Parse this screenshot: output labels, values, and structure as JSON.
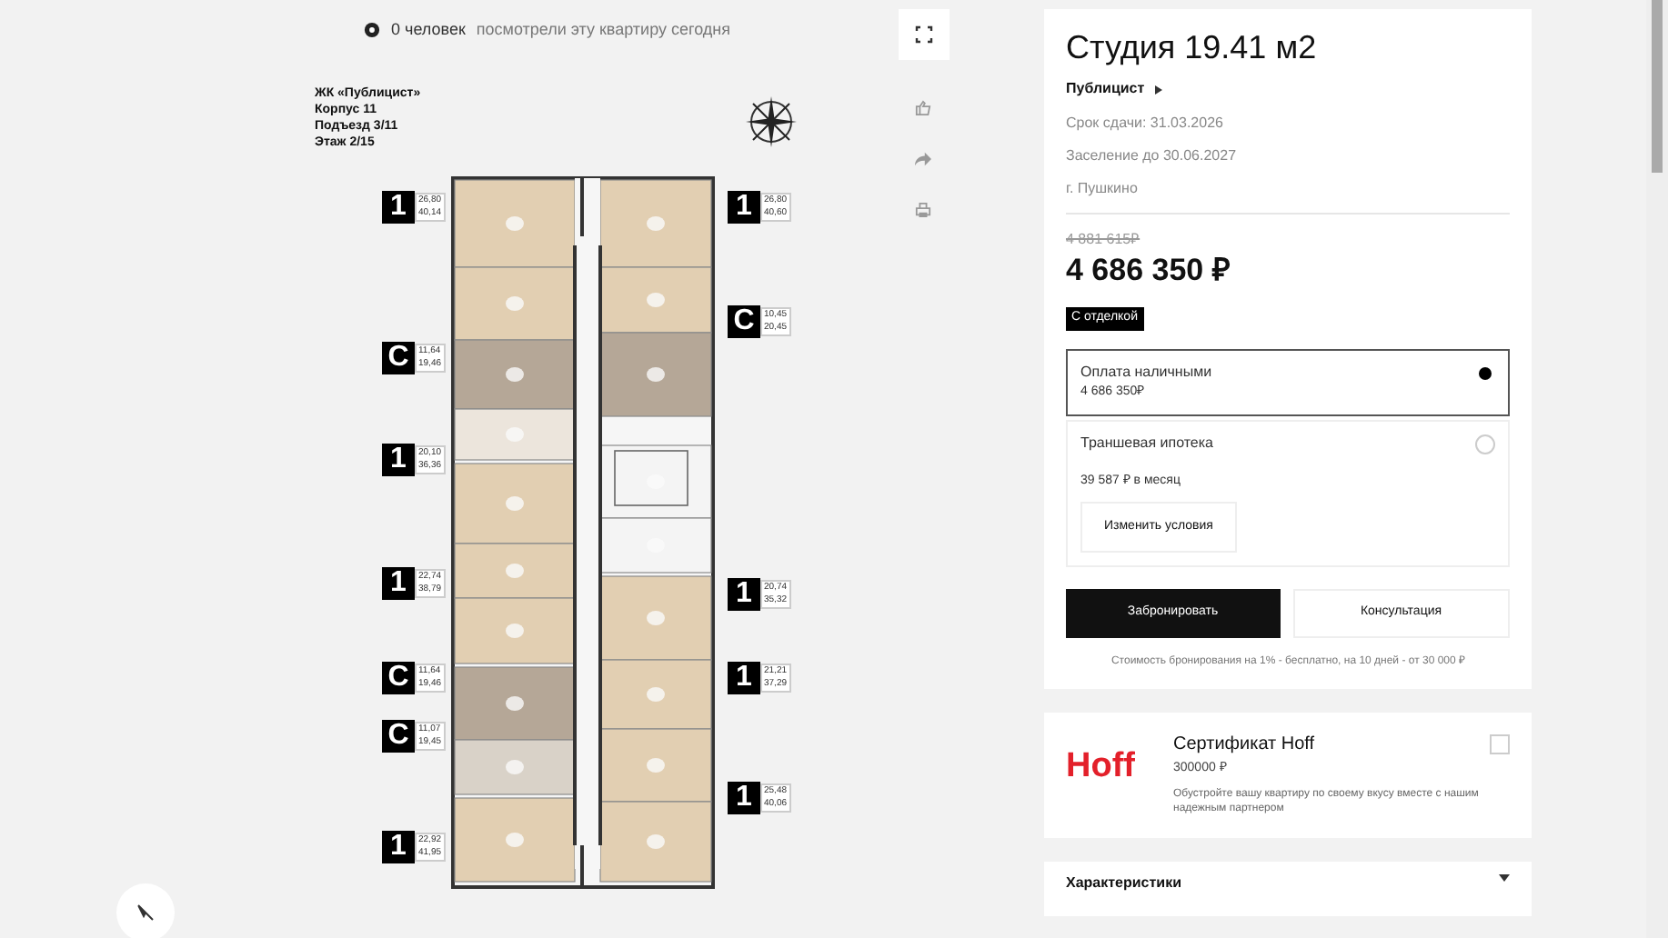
{
  "viewers": {
    "count": "0 человек",
    "text": "посмотрели эту квартиру сегодня"
  },
  "building_info": [
    "ЖК «Публицист»",
    "Корпус 11",
    "Подъезд 3/11",
    "Этаж 2/15"
  ],
  "plan_badges": [
    {
      "type": "1",
      "area": "26,80",
      "total": "40,14"
    },
    {
      "type": "C",
      "area": "11,64",
      "total": "19,46"
    },
    {
      "type": "1",
      "area": "20,10",
      "total": "36,36"
    },
    {
      "type": "1",
      "area": "22,74",
      "total": "38,79"
    },
    {
      "type": "C",
      "area": "11,64",
      "total": "19,46"
    },
    {
      "type": "C",
      "area": "11,07",
      "total": "19,45"
    },
    {
      "type": "1",
      "area": "22,92",
      "total": "41,95"
    },
    {
      "type": "1",
      "area": "26,80",
      "total": "40,60"
    },
    {
      "type": "C",
      "area": "10,45",
      "total": "20,45"
    },
    {
      "type": "1",
      "area": "20,74",
      "total": "35,32"
    },
    {
      "type": "1",
      "area": "21,21",
      "total": "37,29"
    },
    {
      "type": "1",
      "area": "25,48",
      "total": "40,06"
    }
  ],
  "offer": {
    "title": "Студия 19.41 м2",
    "project": "Публицист",
    "details": [
      "Срок сдачи: 31.03.2026",
      "Заселение до 30.06.2027",
      "г. Пушкино"
    ],
    "old_price": "4 881 615₽",
    "price": "4 686 350 ₽",
    "badge": "С отделкой",
    "payment_options": [
      {
        "title": "Оплата наличными",
        "subtitle": "4 686 350₽",
        "selected": true
      },
      {
        "title": "Траншевая ипотека",
        "subtitle": "39 587 ₽ в месяц",
        "button": "Изменить условия",
        "selected": false
      }
    ],
    "primary_button": "Забронировать",
    "secondary_button": "Консультация",
    "note": "Стоимость бронирования на 1% - бесплатно, на 10 дней - от 30 000 ₽"
  },
  "certificate": {
    "logo": "Hoff",
    "title": "Сертификат Hoff",
    "price": "300000 ₽",
    "description": "Обустройте вашу квартиру по своему вкусу вместе с нашим надежным партнером",
    "checked": false
  },
  "characteristics": {
    "title": "Характеристики",
    "expanded": false
  }
}
